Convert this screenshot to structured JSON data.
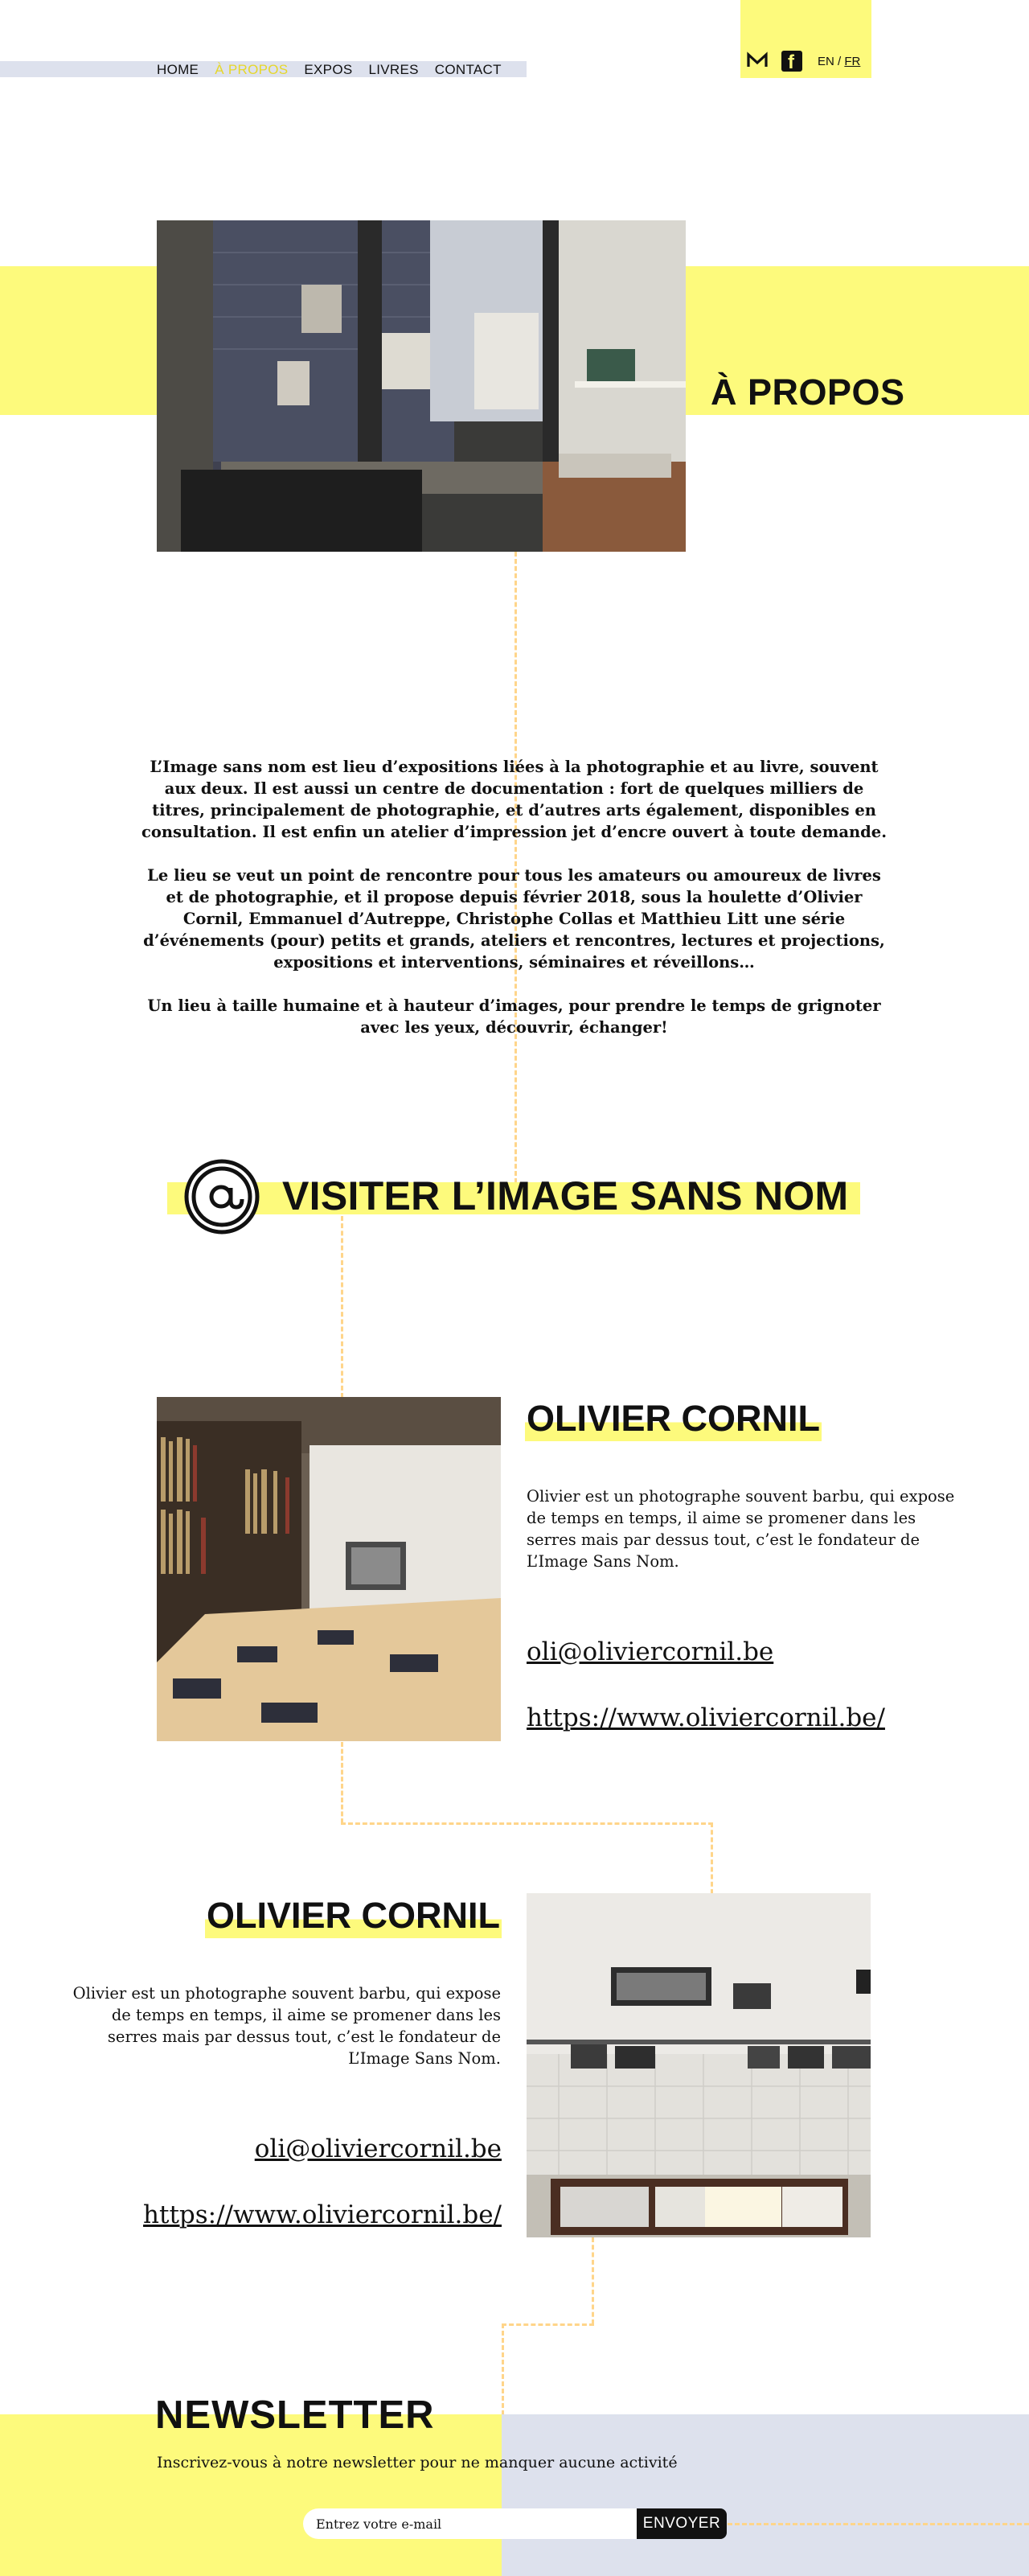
{
  "nav": {
    "items": [
      {
        "label": "HOME",
        "active": false
      },
      {
        "label": "À PROPOS",
        "active": true
      },
      {
        "label": "EXPOS",
        "active": false
      },
      {
        "label": "LIVRES",
        "active": false
      },
      {
        "label": "CONTACT",
        "active": false
      }
    ]
  },
  "social": {
    "icons": [
      "mail-icon",
      "facebook-icon"
    ]
  },
  "lang": {
    "en": "EN",
    "sep": " / ",
    "fr": "FR",
    "current": "FR"
  },
  "about": {
    "title": "À PROPOS",
    "paragraphs": [
      "L’Image sans nom est lieu d’expositions liées à la photographie et au livre, souvent aux deux. Il est aussi un centre de documentation : fort de quelques milliers de titres, principalement de photographie, et d’autres arts également, disponibles en consultation. Il est enfin un atelier d’impression jet d’encre ouvert à toute demande.",
      "Le lieu se veut un point de rencontre pour tous les amateurs ou amoureux de livres et de photographie, et il propose depuis février 2018, sous la houlette d’Olivier Cornil, Emmanuel d’Autreppe, Christophe Collas et Matthieu Litt une série d’événements (pour) petits et grands, ateliers et rencontres, lectures et projections, expositions et interventions, séminaires et réveillons…",
      "Un lieu à taille humaine et à hauteur d’images, pour prendre le temps de grignoter avec les yeux, découvrir, échanger!"
    ]
  },
  "visit": {
    "title": "VISITER L’IMAGE SANS NOM"
  },
  "people": [
    {
      "name": "OLIVIER CORNIL",
      "description": "Olivier est un photographe souvent barbu, qui expose de temps en temps, il aime se promener dans les serres mais par dessus tout, c’est le fondateur de L’Image Sans Nom.",
      "email": "oli@oliviercornil.be",
      "website": "https://www.oliviercornil.be/"
    },
    {
      "name": "OLIVIER CORNIL",
      "description": "Olivier est un photographe souvent barbu, qui expose de temps en temps, il aime se promener dans les serres mais par dessus tout, c’est le fondateur de L’Image Sans Nom.",
      "email": "oli@oliviercornil.be",
      "website": "https://www.oliviercornil.be/"
    }
  ],
  "newsletter": {
    "title": "NEWSLETTER",
    "subtitle": "Inscrivez-vous à notre newsletter pour ne manquer aucune activité",
    "placeholder": "Entrez votre e-mail",
    "button": "ENVOYER"
  },
  "colors": {
    "yellow": "#fdfa7c",
    "grey_blue": "#dde1ed",
    "dash": "#ffd58a",
    "nav_active": "#e6d72a"
  }
}
